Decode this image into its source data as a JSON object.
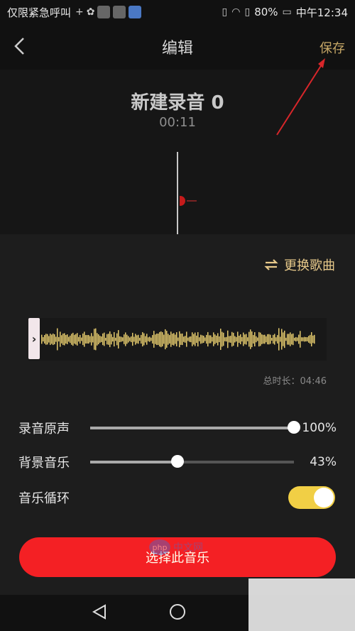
{
  "status_bar": {
    "carrier": "仅限紧急呼叫",
    "battery": "80%",
    "time": "中午12:34"
  },
  "header": {
    "title": "编辑",
    "save_label": "保存"
  },
  "recording": {
    "name": "新建录音 0",
    "elapsed": "00:11"
  },
  "music": {
    "change_song_label": "更换歌曲",
    "total_duration": "总时长：04:46"
  },
  "controls": {
    "original_label": "录音原声",
    "original_value": "100%",
    "original_level": 1.0,
    "bg_label": "背景音乐",
    "bg_value": "43%",
    "bg_level": 0.43,
    "loop_label": "音乐循环",
    "loop_on": true
  },
  "select_button_label": "选择此音乐",
  "watermark": {
    "logo_text": "php",
    "site": "中文网"
  },
  "colors": {
    "accent_red": "#f42024",
    "gold": "#c6a766",
    "toggle_yellow": "#f1cf45"
  }
}
